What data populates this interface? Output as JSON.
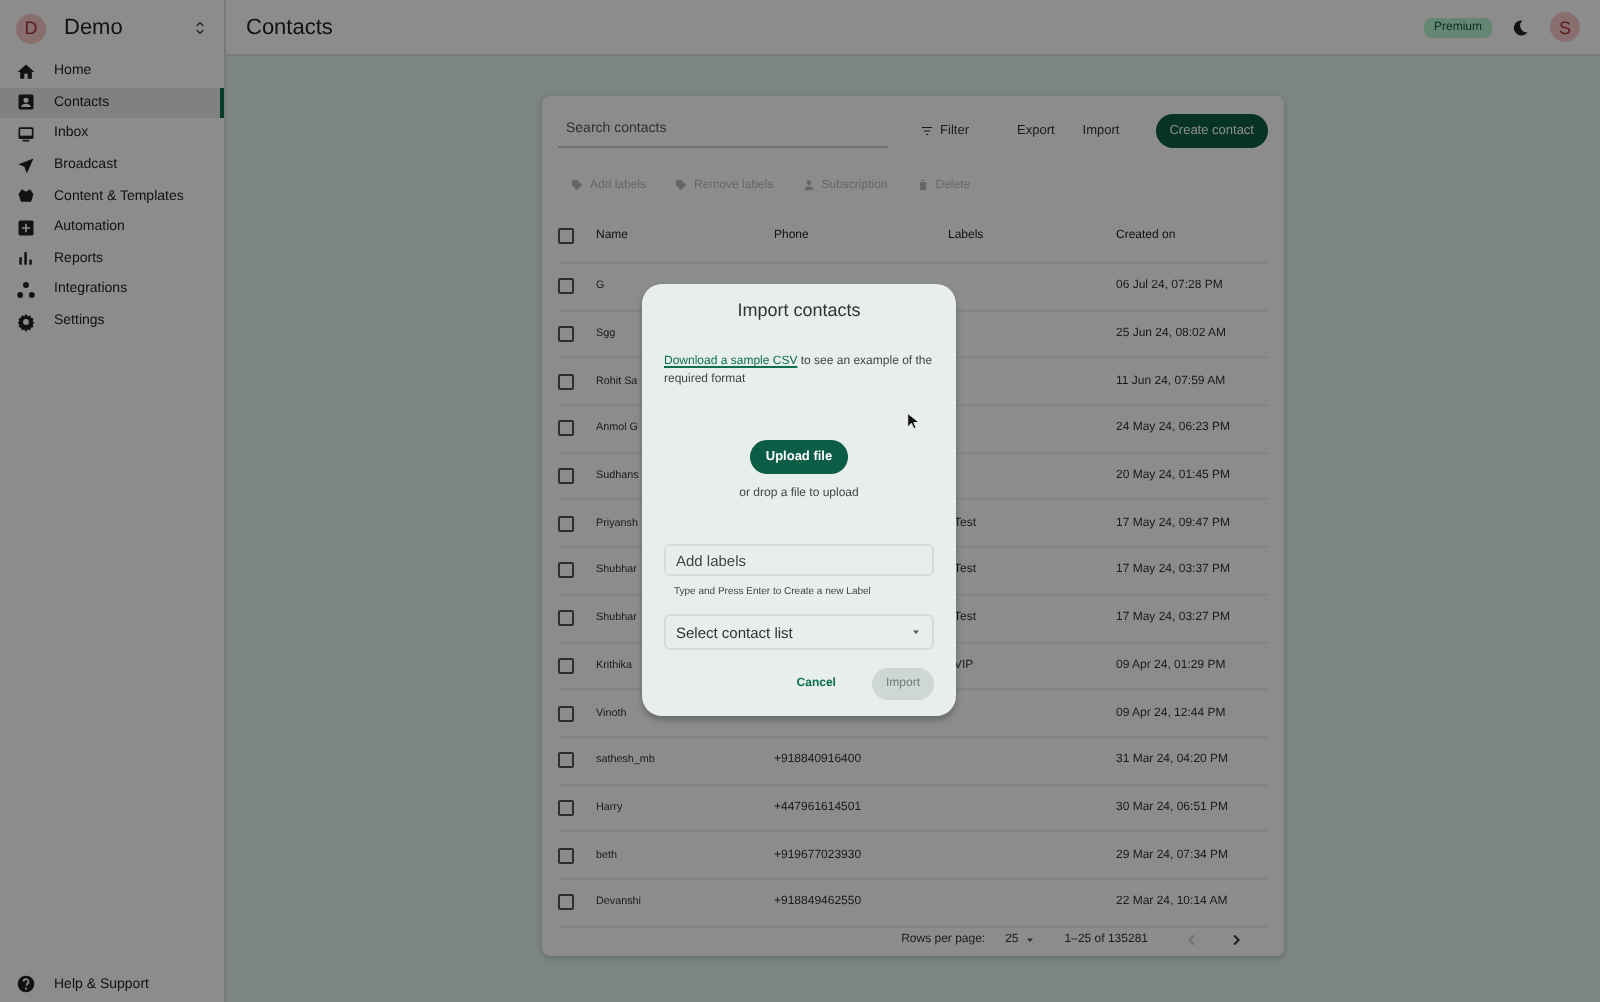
{
  "workspace": {
    "initial": "D",
    "name": "Demo"
  },
  "page_title": "Contacts",
  "plan_badge": "Premium",
  "user_initial": "S",
  "sidebar": {
    "items": [
      {
        "label": "Home",
        "selected": false
      },
      {
        "label": "Contacts",
        "selected": true
      },
      {
        "label": "Inbox",
        "selected": false
      },
      {
        "label": "Broadcast",
        "selected": false
      },
      {
        "label": "Content & Templates",
        "selected": false
      },
      {
        "label": "Automation",
        "selected": false
      },
      {
        "label": "Reports",
        "selected": false
      },
      {
        "label": "Integrations",
        "selected": false
      },
      {
        "label": "Settings",
        "selected": false
      }
    ],
    "footer": "Help & Support"
  },
  "toolbar": {
    "search": {
      "placeholder": "Search contacts"
    },
    "filter": "Filter",
    "export": "Export",
    "import": "Import",
    "create": "Create contact"
  },
  "bulk_actions": [
    {
      "label": "Add labels",
      "disabled": true
    },
    {
      "label": "Remove labels",
      "disabled": true
    },
    {
      "label": "Subscription",
      "disabled": true
    },
    {
      "label": "Delete",
      "disabled": true
    }
  ],
  "table": {
    "all_checked": false,
    "columns": [
      "Name",
      "Phone",
      "Labels",
      "Created on"
    ],
    "rows": [
      {
        "name": "G",
        "created": "06 Jul 24, 07:28 PM",
        "checked": false
      },
      {
        "name": "Sgg",
        "created": "25 Jun 24, 08:02 AM",
        "checked": false
      },
      {
        "name": "Rohit Sa",
        "created": "11 Jun 24, 07:59 AM",
        "checked": false
      },
      {
        "name": "Anmol G",
        "created": "24 May 24, 06:23 PM",
        "checked": false
      },
      {
        "name": "Sudhans",
        "created": "20 May 24, 01:45 PM",
        "checked": false
      },
      {
        "name": "Priyansh",
        "label": "Test",
        "created": "17 May 24, 09:47 PM",
        "checked": false
      },
      {
        "name": "Shubhar",
        "label": "Test",
        "created": "17 May 24, 03:37 PM",
        "checked": false
      },
      {
        "name": "Shubhar",
        "label": "Test",
        "created": "17 May 24, 03:27 PM",
        "checked": false
      },
      {
        "name": "Krithika",
        "label": "VIP",
        "created": "09 Apr 24, 01:29 PM",
        "checked": false
      },
      {
        "name": "Vinoth",
        "created": "09 Apr 24, 12:44 PM",
        "checked": false
      },
      {
        "name": "sathesh_mb",
        "phone": "+918840916400",
        "created": "31 Mar 24, 04:20 PM",
        "checked": false
      },
      {
        "name": "Harry",
        "phone": "+447961614501",
        "created": "30 Mar 24, 06:51 PM",
        "checked": false
      },
      {
        "name": "beth",
        "phone": "+919677023930",
        "created": "29 Mar 24, 07:34 PM",
        "checked": false
      },
      {
        "name": "Devanshi",
        "phone": "+918849462550",
        "created": "22 Mar 24, 10:14 AM",
        "checked": false
      }
    ]
  },
  "pagination": {
    "rows_per_page_label": "Rows per page:",
    "rows_per_page": "25",
    "range": "1–25 of 135281"
  },
  "modal": {
    "title": "Import contacts",
    "link": "Download a sample CSV",
    "text": " to see an example of the required format",
    "upload": "Upload file",
    "drop_hint": "or drop a file to upload",
    "labels": {
      "placeholder": "Add labels"
    },
    "labels_hint": "Type and Press Enter to Create a new Label",
    "list": {
      "placeholder": "Select contact list"
    },
    "cancel": "Cancel",
    "import": {
      "label": "Import",
      "disabled": true
    }
  }
}
